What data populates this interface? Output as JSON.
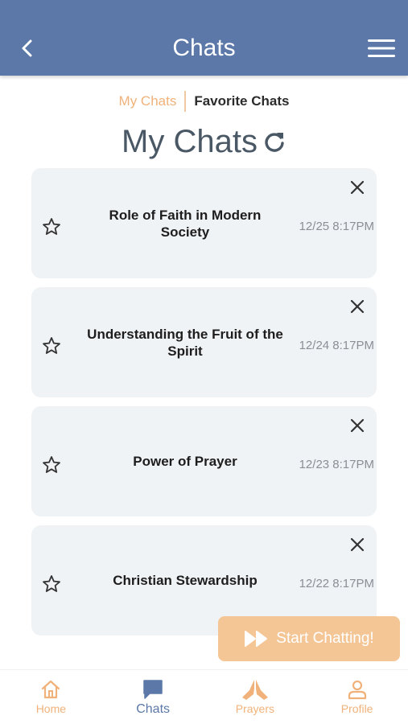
{
  "header": {
    "title": "Chats",
    "color": "#5b78a8"
  },
  "tabs": [
    {
      "label": "My Chats",
      "active": true
    },
    {
      "label": "Favorite Chats",
      "active": false
    }
  ],
  "section": {
    "title": "My Chats"
  },
  "chats": [
    {
      "title": "Role of Faith in Modern Society",
      "time": "12/25 8:17PM"
    },
    {
      "title": "Understanding the Fruit of the Spirit",
      "time": "12/24 8:17PM"
    },
    {
      "title": "Power of Prayer",
      "time": "12/23 8:17PM"
    },
    {
      "title": "Christian Stewardship",
      "time": "12/22 8:17PM"
    }
  ],
  "start_button": {
    "label": "Start Chatting!",
    "color": "#f4c595"
  },
  "nav": [
    {
      "label": "Home",
      "icon": "home-icon"
    },
    {
      "label": "Chats",
      "icon": "chat-bubble-icon",
      "active": true
    },
    {
      "label": "Prayers",
      "icon": "praying-hands-icon"
    },
    {
      "label": "Profile",
      "icon": "person-icon"
    }
  ],
  "accent_color": "#f0b27a"
}
